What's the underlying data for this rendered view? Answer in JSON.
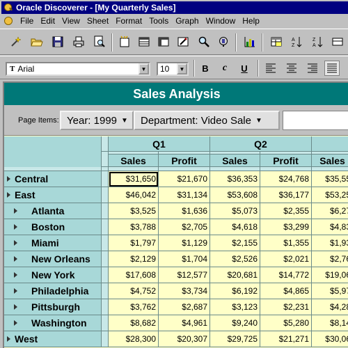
{
  "window": {
    "title": "Oracle Discoverer - [My Quarterly Sales]"
  },
  "menu": [
    "File",
    "Edit",
    "View",
    "Sheet",
    "Format",
    "Tools",
    "Graph",
    "Window",
    "Help"
  ],
  "toolbar1": {
    "icons": [
      "wizard-icon",
      "open-icon",
      "save-icon",
      "print-icon",
      "print-preview-icon",
      "new-sheet-icon",
      "table-icon",
      "crosstab-icon",
      "edit-sheet-icon",
      "find-icon",
      "sql-inspect-icon",
      "graph-icon",
      "format-icon",
      "sort-ascending-icon",
      "sort-descending-icon"
    ]
  },
  "toolbar2": {
    "font_name": "Arial",
    "font_size": "10",
    "format_buttons": [
      {
        "name": "bold-button",
        "glyph": "B"
      },
      {
        "name": "italic-button",
        "glyph": "c"
      },
      {
        "name": "underline-button",
        "glyph": "U"
      }
    ],
    "align_icons": [
      "align-left-icon",
      "align-center-icon",
      "align-right-icon",
      "justify-icon"
    ]
  },
  "sheet": {
    "banner": "Sales Analysis",
    "page_items_label": "Page Items:",
    "page_items": [
      "Year: 1999",
      "Department: Video Sale"
    ]
  },
  "crosstab": {
    "quarters": [
      "Q1",
      "Q2",
      ""
    ],
    "measures": [
      "Sales",
      "Profit",
      "Sales",
      "Profit",
      "Sales"
    ],
    "rows": [
      {
        "label": "Central",
        "level": 0,
        "values": [
          "$31,650",
          "$21,670",
          "$36,353",
          "$24,768",
          "$35,55"
        ]
      },
      {
        "label": "East",
        "level": 0,
        "values": [
          "$46,042",
          "$31,134",
          "$53,608",
          "$36,177",
          "$53,25"
        ]
      },
      {
        "label": "Atlanta",
        "level": 1,
        "values": [
          "$3,525",
          "$1,636",
          "$5,073",
          "$2,355",
          "$6,27"
        ]
      },
      {
        "label": "Boston",
        "level": 1,
        "values": [
          "$3,788",
          "$2,705",
          "$4,618",
          "$3,299",
          "$4,83"
        ]
      },
      {
        "label": "Miami",
        "level": 1,
        "values": [
          "$1,797",
          "$1,129",
          "$2,155",
          "$1,355",
          "$1,93"
        ]
      },
      {
        "label": "New Orleans",
        "level": 1,
        "values": [
          "$2,129",
          "$1,704",
          "$2,526",
          "$2,021",
          "$2,76"
        ]
      },
      {
        "label": "New York",
        "level": 1,
        "values": [
          "$17,608",
          "$12,577",
          "$20,681",
          "$14,772",
          "$19,06"
        ]
      },
      {
        "label": "Philadelphia",
        "level": 1,
        "values": [
          "$4,752",
          "$3,734",
          "$6,192",
          "$4,865",
          "$5,97"
        ]
      },
      {
        "label": "Pittsburgh",
        "level": 1,
        "values": [
          "$3,762",
          "$2,687",
          "$3,123",
          "$2,231",
          "$4,28"
        ]
      },
      {
        "label": "Washington",
        "level": 1,
        "values": [
          "$8,682",
          "$4,961",
          "$9,240",
          "$5,280",
          "$8,14"
        ]
      },
      {
        "label": "West",
        "level": 0,
        "values": [
          "$28,300",
          "$20,307",
          "$29,725",
          "$21,271",
          "$30,06"
        ]
      }
    ]
  }
}
